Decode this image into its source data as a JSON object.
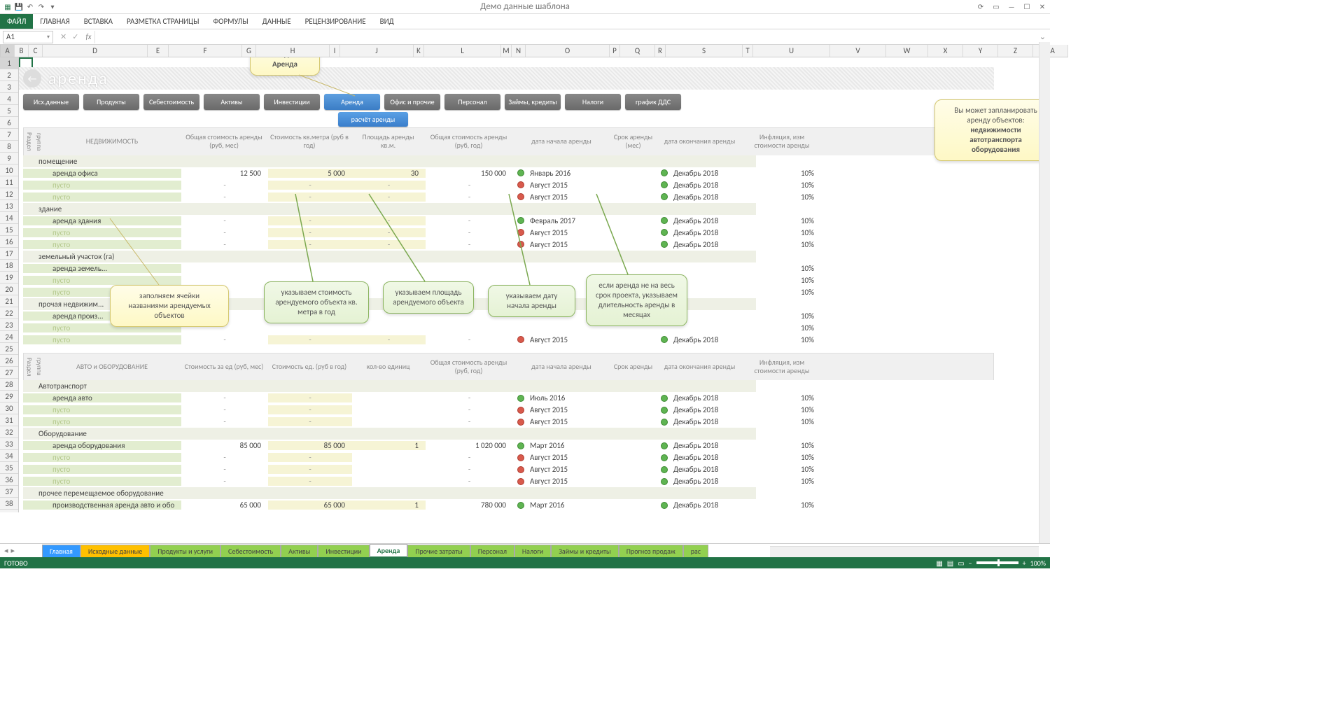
{
  "title": "Демо данные шаблона",
  "ribbon": {
    "file": "ФАЙЛ",
    "tabs": [
      "ГЛАВНАЯ",
      "ВСТАВКА",
      "РАЗМЕТКА СТРАНИЦЫ",
      "ФОРМУЛЫ",
      "ДАННЫЕ",
      "РЕЦЕНЗИРОВАНИЕ",
      "ВИД"
    ]
  },
  "name_box": "A1",
  "watermark": "аренда",
  "nav": [
    "Исх.данные",
    "Продукты",
    "Себестоимость",
    "Активы",
    "Инвестиции",
    "Аренда",
    "Офис и прочие",
    "Персонал",
    "Займы, кредиты",
    "Налоги",
    "график ДДС"
  ],
  "nav_active": 5,
  "nav_sub": "расчёт аренды",
  "vcols": [
    "Раздел",
    "группа"
  ],
  "headers1": [
    "НЕДВИЖИМОСТЬ",
    "Общая стоимость аренды (руб, мес)",
    "Стоимость кв.метра (руб в год)",
    "Площадь аренды кв.м.",
    "Общая стоимость аренды (руб, год)",
    "дата начала аренды",
    "Срок аренды (мес)",
    "дата окончания аренды",
    "Инфляция, изм стоимости аренды"
  ],
  "headers2": [
    "АВТО и ОБОРУДОВАНИЕ",
    "Стоимость за ед (руб, мес)",
    "Стоимость ед. (руб в год)",
    "кол-во единиц",
    "Общая стоимость аренды (руб, год)",
    "дата начала аренды",
    "Срок аренды",
    "дата окончания аренды",
    "Инфляция, изм стоимости аренды"
  ],
  "empty": "пусто",
  "sections": [
    {
      "name": "помещение",
      "rows": [
        {
          "n": "аренда офиса",
          "v": [
            "12 500",
            "5 000",
            "30",
            "150 000"
          ],
          "d1g": true,
          "d1": "Январь 2016",
          "d2": "Декабрь 2018",
          "inf": "10%"
        },
        {
          "n": "",
          "v": [
            "-",
            "-",
            "-",
            "-"
          ],
          "d1g": false,
          "d1": "Август 2015",
          "d2": "Декабрь 2018",
          "inf": "10%"
        },
        {
          "n": "",
          "v": [
            "-",
            "-",
            "-",
            "-"
          ],
          "d1g": false,
          "d1": "Август 2015",
          "d2": "Декабрь 2018",
          "inf": "10%"
        }
      ]
    },
    {
      "name": "здание",
      "rows": [
        {
          "n": "аренда здания",
          "v": [
            "-",
            "-",
            "-",
            "-"
          ],
          "d1g": true,
          "d1": "Февраль 2017",
          "d2": "Декабрь 2018",
          "inf": "10%"
        },
        {
          "n": "",
          "v": [
            "-",
            "-",
            "-",
            "-"
          ],
          "d1g": false,
          "d1": "Август 2015",
          "d2": "Декабрь 2018",
          "inf": "10%"
        },
        {
          "n": "",
          "v": [
            "-",
            "-",
            "-",
            "-"
          ],
          "d1g": false,
          "d1": "Август 2015",
          "d2": "Декабрь 2018",
          "inf": "10%"
        }
      ]
    },
    {
      "name": "земельный участок (га)",
      "rows": [
        {
          "n": "аренда земель...",
          "v": [
            "",
            "",
            "",
            ""
          ],
          "d1g": null,
          "d1": "",
          "d2": "",
          "inf": "10%"
        },
        {
          "n": "",
          "v": [
            "",
            "",
            "",
            ""
          ],
          "d1g": null,
          "d1": "",
          "d2": "",
          "inf": "10%"
        },
        {
          "n": "",
          "v": [
            "",
            "",
            "",
            ""
          ],
          "d1g": null,
          "d1": "",
          "d2": "",
          "inf": "10%"
        }
      ]
    },
    {
      "name": "прочая недвижим...",
      "rows": [
        {
          "n": "аренда произ...",
          "v": [
            "",
            "",
            "",
            ""
          ],
          "d1g": null,
          "d1": "",
          "d2": "",
          "inf": "10%"
        },
        {
          "n": "",
          "v": [
            "",
            "",
            "",
            ""
          ],
          "d1g": null,
          "d1": "",
          "d2": "",
          "inf": "10%"
        },
        {
          "n": "",
          "v": [
            "-",
            "-",
            "-",
            "-"
          ],
          "d1g": false,
          "d1": "Август 2015",
          "d2": "Декабрь 2018",
          "inf": "10%"
        }
      ]
    }
  ],
  "sections2": [
    {
      "name": "Автотранспорт",
      "rows": [
        {
          "n": "аренда авто",
          "v": [
            "-",
            "-",
            "",
            "-"
          ],
          "d1g": true,
          "d1": "Июль 2016",
          "d2": "Декабрь 2018",
          "inf": "10%"
        },
        {
          "n": "",
          "v": [
            "-",
            "-",
            "",
            "-"
          ],
          "d1g": false,
          "d1": "Август 2015",
          "d2": "Декабрь 2018",
          "inf": "10%"
        },
        {
          "n": "",
          "v": [
            "-",
            "-",
            "",
            "-"
          ],
          "d1g": false,
          "d1": "Август 2015",
          "d2": "Декабрь 2018",
          "inf": "10%"
        }
      ]
    },
    {
      "name": "Оборудование",
      "rows": [
        {
          "n": "аренда оборудования",
          "v": [
            "85 000",
            "85 000",
            "1",
            "1 020 000"
          ],
          "d1g": true,
          "d1": "Март 2016",
          "d2": "Декабрь 2018",
          "inf": "10%"
        },
        {
          "n": "",
          "v": [
            "-",
            "-",
            "",
            "-"
          ],
          "d1g": false,
          "d1": "Август 2015",
          "d2": "Декабрь 2018",
          "inf": "10%"
        },
        {
          "n": "",
          "v": [
            "-",
            "-",
            "",
            "-"
          ],
          "d1g": false,
          "d1": "Август 2015",
          "d2": "Декабрь 2018",
          "inf": "10%"
        },
        {
          "n": "",
          "v": [
            "-",
            "-",
            "",
            "-"
          ],
          "d1g": false,
          "d1": "Август 2015",
          "d2": "Декабрь 2018",
          "inf": "10%"
        }
      ]
    },
    {
      "name": "прочее перемещаемое оборудование",
      "rows": [
        {
          "n": "производственная аренда авто и обо",
          "v": [
            "65 000",
            "65 000",
            "1",
            "780 000"
          ],
          "d1g": true,
          "d1": "Март 2016",
          "d2": "Декабрь 2018",
          "inf": "10%"
        },
        {
          "n": "",
          "v": [
            "-",
            "-",
            "",
            "-"
          ],
          "d1g": false,
          "d1": "Август 2015",
          "d2": "Декабрь 2018",
          "inf": "10%"
        }
      ]
    }
  ],
  "callouts": {
    "section": {
      "l1": "Раздел",
      "l2": "Аренда"
    },
    "right": {
      "l1": "Вы может запланировать аренду объектов:",
      "l2": "недвижимости",
      "l3": "автотранспорта",
      "l4": "оборудования"
    },
    "c1": "заполняем ячейки названиями арендуемых объектов",
    "c2": "указываем стоимость арендуемого объекта кв. метра в год",
    "c3": "указываем площадь арендуемого объекта",
    "c4": "указываем дату начала аренды",
    "c5": "если аренда не на весь срок проекта, указываем длительность аренды в месяцах"
  },
  "col_letters": [
    "A",
    "B",
    "C",
    "D",
    "E",
    "F",
    "G",
    "H",
    "I",
    "J",
    "K",
    "L",
    "M",
    "N",
    "O",
    "P",
    "Q",
    "R",
    "S",
    "T",
    "U",
    "V",
    "W",
    "X",
    "Y",
    "Z",
    "AA"
  ],
  "sheet_tabs": [
    {
      "n": "Главная",
      "c": "blue"
    },
    {
      "n": "Исходные данные",
      "c": "orange"
    },
    {
      "n": "Продукты и услуги",
      "c": "grn"
    },
    {
      "n": "Себестоимость",
      "c": "grn"
    },
    {
      "n": "Активы",
      "c": "grn"
    },
    {
      "n": "Инвестиции",
      "c": "grn"
    },
    {
      "n": "Аренда",
      "c": "sel"
    },
    {
      "n": "Прочие затраты",
      "c": "grn"
    },
    {
      "n": "Персонал",
      "c": "grn"
    },
    {
      "n": "Налоги",
      "c": "grn"
    },
    {
      "n": "Займы и кредиты",
      "c": "grn"
    },
    {
      "n": "Прогноз продаж",
      "c": "grn"
    },
    {
      "n": "рас",
      "c": "grn"
    }
  ],
  "status": "ГОТОВО",
  "zoom": "100%"
}
